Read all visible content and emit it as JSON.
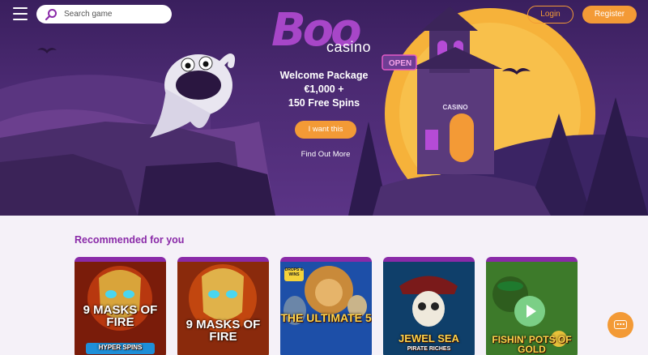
{
  "header": {
    "search_placeholder": "Search game",
    "login_label": "Login",
    "register_label": "Register"
  },
  "logo": {
    "brand": "Boo",
    "sub": "casino"
  },
  "hero": {
    "line1": "Welcome Package",
    "line2": "€1,000 +",
    "line3": "150 Free Spins",
    "cta_label": "I want this",
    "find_more_label": "Find Out More",
    "sign_open": "OPEN",
    "sign_casino": "CASINO"
  },
  "recommended": {
    "title": "Recommended for you",
    "games": [
      {
        "title": "9 MASKS OF FIRE",
        "sub": "HYPER SPINS"
      },
      {
        "title": "9 MASKS OF FIRE",
        "sub": ""
      },
      {
        "title": "THE ULTIMATE 5",
        "sub": "DROPS & WINS"
      },
      {
        "title": "JEWEL SEA",
        "sub": "PIRATE RICHES"
      },
      {
        "title": "FISHIN' POTS OF GOLD",
        "sub": ""
      }
    ]
  },
  "colors": {
    "accent": "#f39a36",
    "brand_purple": "#8a2aa8",
    "hero_bg": "#4b2a72"
  }
}
